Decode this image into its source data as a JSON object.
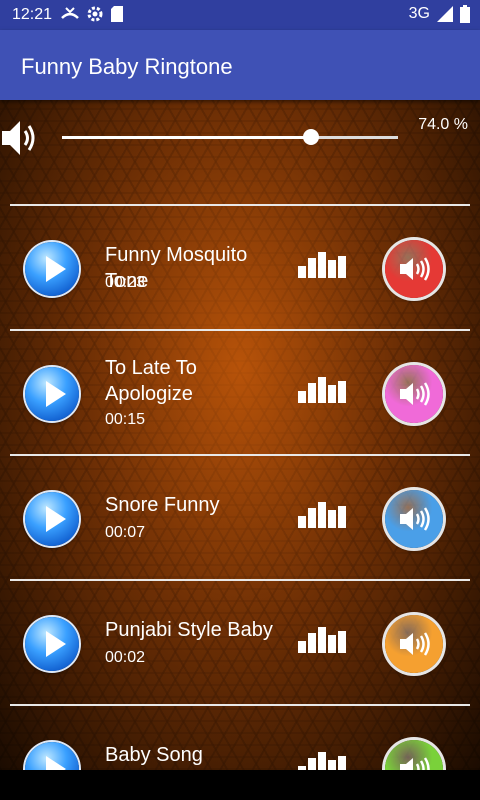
{
  "status": {
    "time": "12:21",
    "network": "3G"
  },
  "app": {
    "title": "Funny Baby Ringtone"
  },
  "volume": {
    "label": "74.0 %",
    "level_percent": 74
  },
  "ringtones": [
    {
      "name": "Funny Mosquito Tone",
      "duration": "00:23",
      "color": "#e53935"
    },
    {
      "name": "To Late To Apologize",
      "duration": "00:15",
      "color": "#f06ad8"
    },
    {
      "name": "Snore Funny",
      "duration": "00:07",
      "color": "#4a9fe8"
    },
    {
      "name": "Punjabi Style Baby",
      "duration": "00:02",
      "color": "#f5a030"
    },
    {
      "name": "Baby Song",
      "duration": "",
      "color": "#7ad13a"
    }
  ],
  "icons": {
    "play": "play-icon",
    "ring": "speaker-icon",
    "equalizer": "equalizer-icon"
  }
}
